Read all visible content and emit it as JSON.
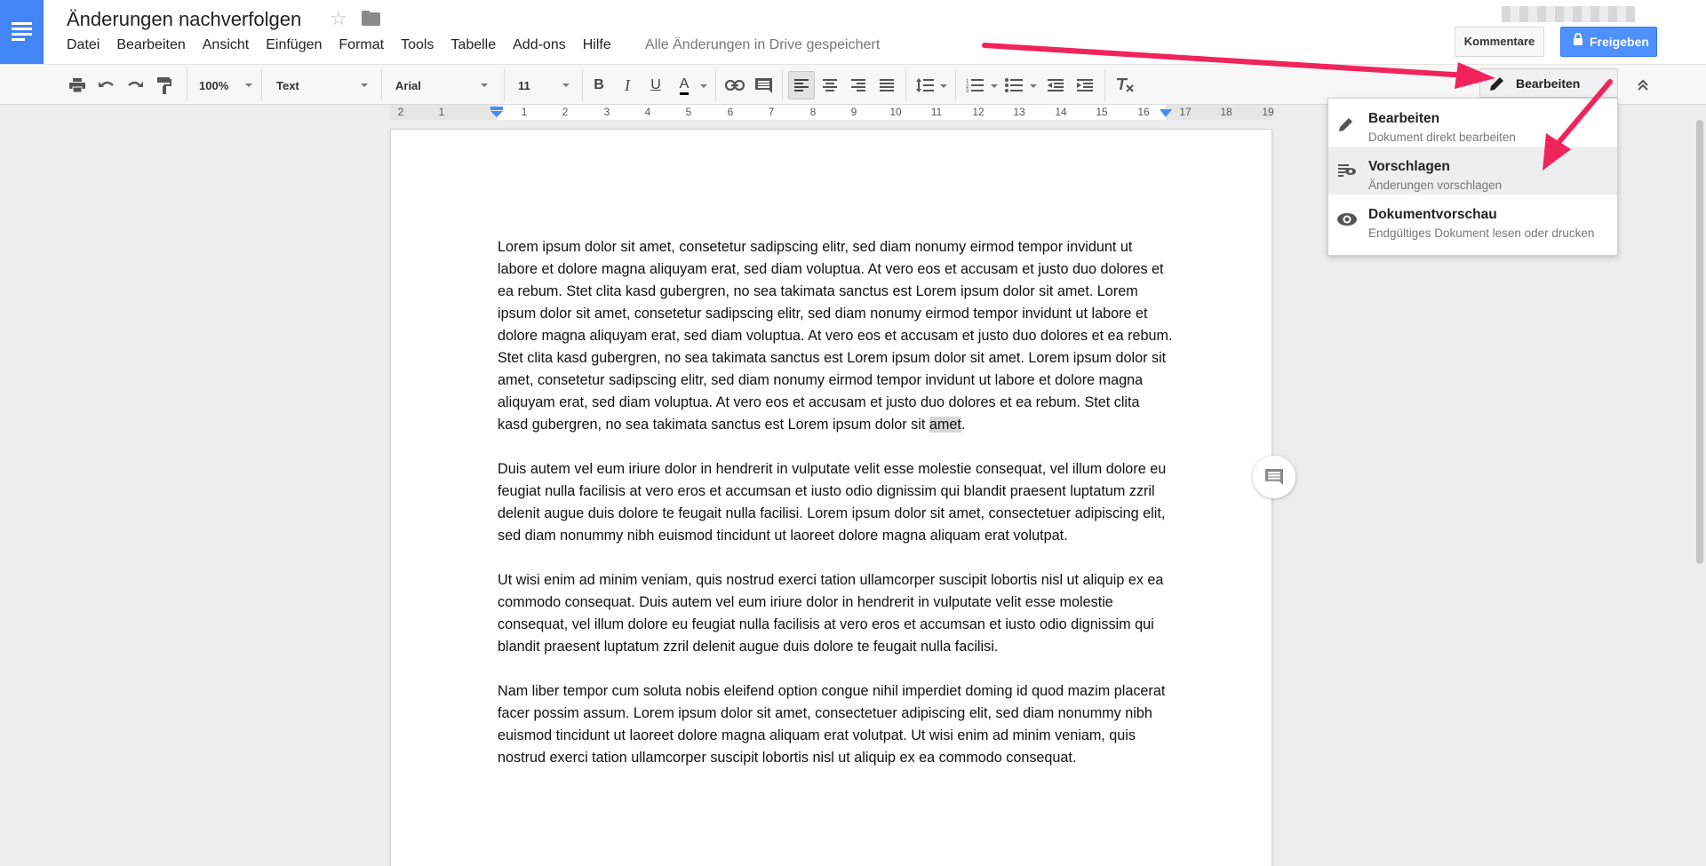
{
  "app": {
    "title": "Änderungen nachverfolgen",
    "save_status": "Alle Änderungen in Drive gespeichert",
    "menu": [
      "Datei",
      "Bearbeiten",
      "Ansicht",
      "Einfügen",
      "Format",
      "Tools",
      "Tabelle",
      "Add-ons",
      "Hilfe"
    ],
    "buttons": {
      "comments": "Kommentare",
      "share": "Freigeben"
    }
  },
  "toolbar": {
    "zoom": "100%",
    "style": "Text",
    "font": "Arial",
    "font_size": "11",
    "bold": "B",
    "italic": "I",
    "underline": "U",
    "text_color": "A",
    "mode_button": "Bearbeiten"
  },
  "ruler": {
    "numbers": [
      "2",
      "1",
      "1",
      "2",
      "3",
      "4",
      "5",
      "6",
      "7",
      "8",
      "9",
      "10",
      "11",
      "12",
      "13",
      "14",
      "15",
      "16",
      "17",
      "18",
      "19"
    ]
  },
  "mode_menu": {
    "items": [
      {
        "title": "Bearbeiten",
        "subtitle": "Dokument direkt bearbeiten",
        "icon": "pencil-icon"
      },
      {
        "title": "Vorschlagen",
        "subtitle": "Änderungen vorschlagen",
        "icon": "suggest-icon"
      },
      {
        "title": "Dokumentvorschau",
        "subtitle": "Endgültiges Dokument lesen oder drucken",
        "icon": "eye-icon"
      }
    ],
    "active_index": 1
  },
  "document": {
    "p1_main": "Lorem ipsum dolor sit amet, consetetur sadipscing elitr, sed diam nonumy eirmod tempor invidunt ut labore et dolore magna aliquyam erat, sed diam voluptua. At vero eos et accusam et justo duo dolores et ea rebum. Stet clita kasd gubergren, no sea takimata sanctus est Lorem ipsum dolor sit amet. Lorem ipsum dolor sit amet, consetetur sadipscing elitr, sed diam nonumy eirmod tempor invidunt ut labore et dolore magna aliquyam erat, sed diam voluptua. At vero eos et accusam et justo duo dolores et ea rebum. Stet clita kasd gubergren, no sea takimata sanctus est Lorem ipsum dolor sit amet. Lorem ipsum dolor sit amet, consetetur sadipscing elitr, sed diam nonumy eirmod tempor invidunt ut labore et dolore magna aliquyam erat, sed diam voluptua. At vero eos et accusam et justo duo dolores et ea rebum. Stet clita kasd gubergren, no sea takimata sanctus est Lorem ipsum dolor sit ",
    "p1_highlight": "amet",
    "p1_end": ".",
    "p2": "Duis autem vel eum iriure dolor in hendrerit in vulputate velit esse molestie consequat, vel illum dolore eu feugiat nulla facilisis at vero eros et accumsan et iusto odio dignissim qui blandit praesent luptatum zzril delenit augue duis dolore te feugait nulla facilisi. Lorem ipsum dolor sit amet, consectetuer adipiscing elit, sed diam nonummy nibh euismod tincidunt ut laoreet dolore magna aliquam erat volutpat.",
    "p3": "Ut wisi enim ad minim veniam, quis nostrud exerci tation ullamcorper suscipit lobortis nisl ut aliquip ex ea commodo consequat. Duis autem vel eum iriure dolor in hendrerit in vulputate velit esse molestie consequat, vel illum dolore eu feugiat nulla facilisis at vero eros et accumsan et iusto odio dignissim qui blandit praesent luptatum zzril delenit augue duis dolore te feugait nulla facilisi.",
    "p4": "Nam liber tempor cum soluta nobis eleifend option congue nihil imperdiet doming id quod mazim placerat facer possim assum. Lorem ipsum dolor sit amet, consectetuer adipiscing elit, sed diam nonummy nibh euismod tincidunt ut laoreet dolore magna aliquam erat volutpat. Ut wisi enim ad minim veniam, quis nostrud exerci tation ullamcorper suscipit lobortis nisl ut aliquip ex ea commodo consequat."
  },
  "colors": {
    "accent": "#4285f4",
    "share_button": "#4d90fe",
    "annotation_arrow": "#f0245a"
  }
}
